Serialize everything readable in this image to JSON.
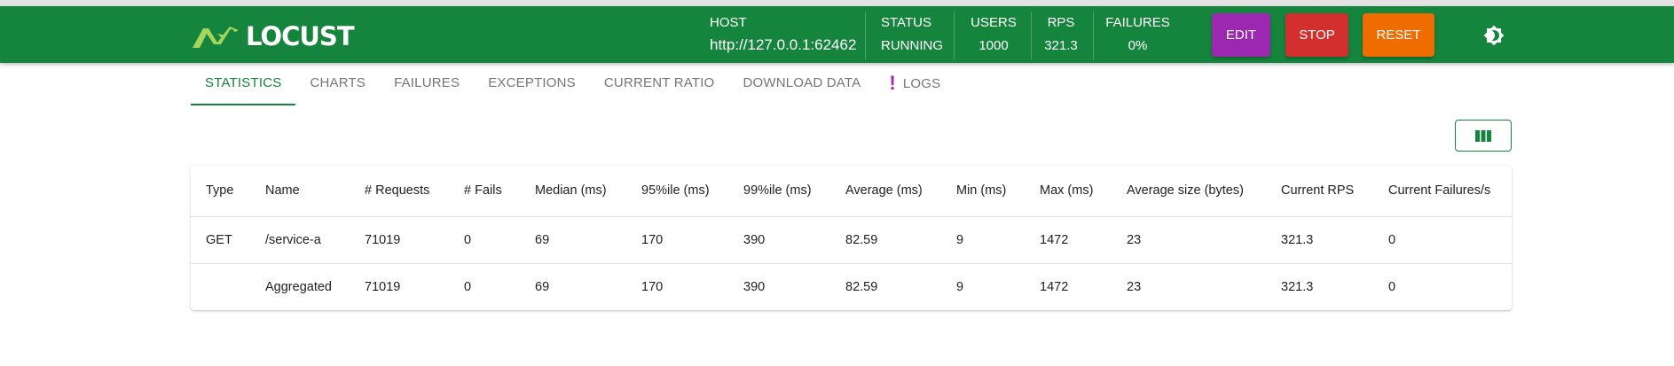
{
  "brand": {
    "name": "LOCUST"
  },
  "header": {
    "host": {
      "label": "HOST",
      "value": "http://127.0.0.1:62462"
    },
    "status": {
      "label": "STATUS",
      "value": "RUNNING"
    },
    "users": {
      "label": "USERS",
      "value": "1000"
    },
    "rps": {
      "label": "RPS",
      "value": "321.3"
    },
    "failures": {
      "label": "FAILURES",
      "value": "0%"
    }
  },
  "actions": {
    "edit": "EDIT",
    "stop": "STOP",
    "reset": "RESET"
  },
  "icons": {
    "theme": "brightness-icon",
    "columns": "view-column-icon",
    "logs_alert": "exclamation-icon",
    "logo": "locust-logo-icon"
  },
  "colors": {
    "primary": "#15843c",
    "edit": "#9c27b0",
    "stop": "#d32f2f",
    "reset": "#ef6c00",
    "logo_accent": "#a4d65e"
  },
  "tabs": [
    {
      "label": "STATISTICS",
      "active": true
    },
    {
      "label": "CHARTS"
    },
    {
      "label": "FAILURES"
    },
    {
      "label": "EXCEPTIONS"
    },
    {
      "label": "CURRENT RATIO"
    },
    {
      "label": "DOWNLOAD DATA"
    },
    {
      "label": "LOGS",
      "alert": "!"
    }
  ],
  "table": {
    "columns": [
      "Type",
      "Name",
      "# Requests",
      "# Fails",
      "Median (ms)",
      "95%ile (ms)",
      "99%ile (ms)",
      "Average (ms)",
      "Min (ms)",
      "Max (ms)",
      "Average size (bytes)",
      "Current RPS",
      "Current Failures/s"
    ],
    "rows": [
      [
        "GET",
        "/service-a",
        "71019",
        "0",
        "69",
        "170",
        "390",
        "82.59",
        "9",
        "1472",
        "23",
        "321.3",
        "0"
      ],
      [
        "",
        "Aggregated",
        "71019",
        "0",
        "69",
        "170",
        "390",
        "82.59",
        "9",
        "1472",
        "23",
        "321.3",
        "0"
      ]
    ]
  }
}
